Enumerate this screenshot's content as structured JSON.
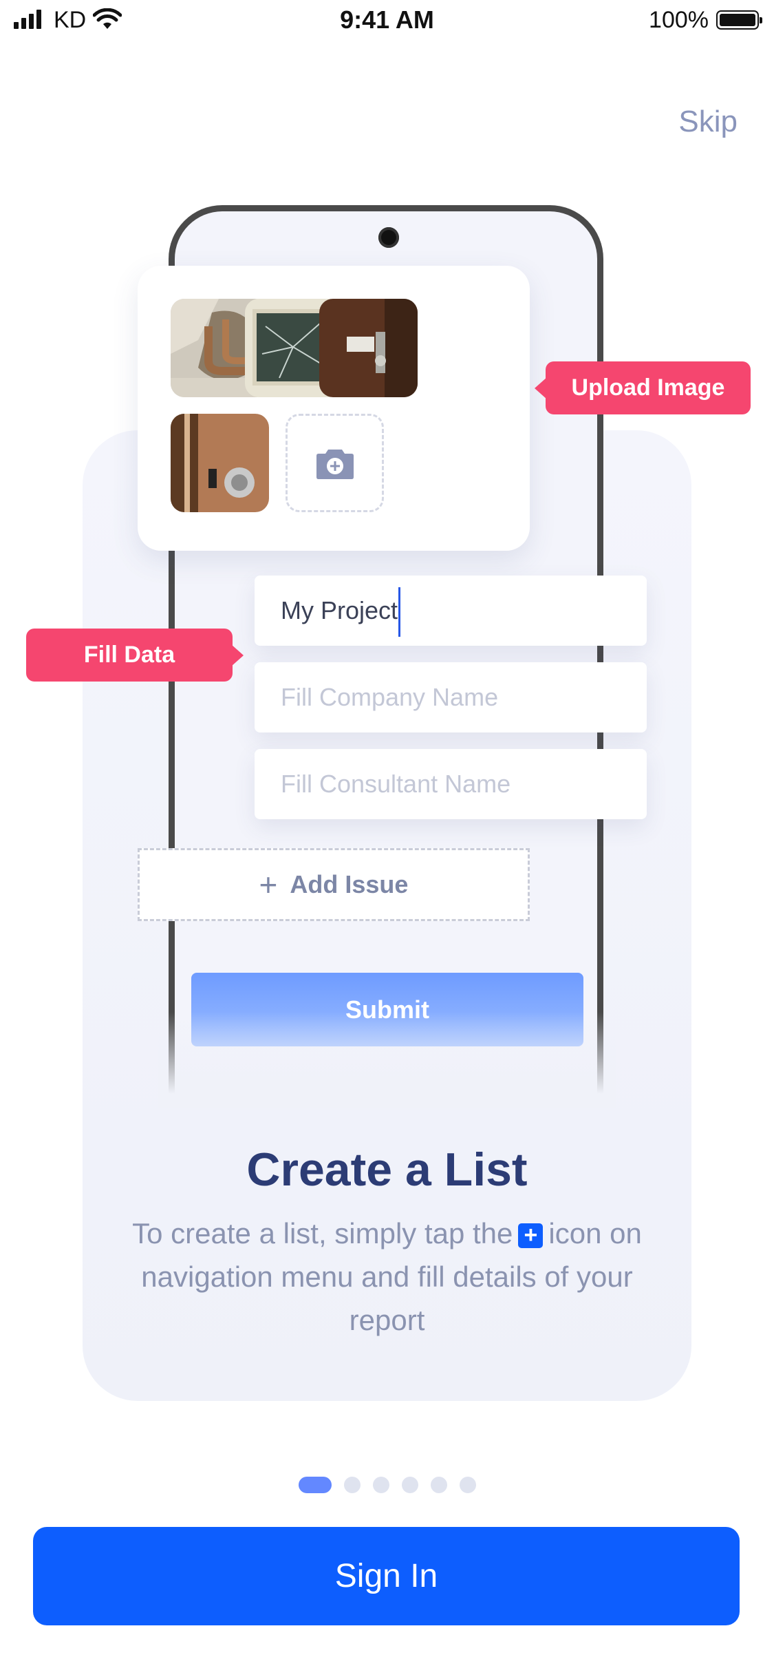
{
  "status_bar": {
    "carrier": "KD",
    "time": "9:41 AM",
    "battery": "100%"
  },
  "skip_label": "Skip",
  "illustration": {
    "upload_tag": "Upload Image",
    "fill_tag": "Fill Data",
    "fields": [
      {
        "value": "My Project"
      },
      {
        "placeholder": "Fill Company Name"
      },
      {
        "placeholder": "Fill Consultant Name"
      }
    ],
    "add_issue_label": "Add Issue",
    "submit_label": "Submit"
  },
  "onboarding": {
    "title": "Create a List",
    "desc_part1": "To create a list, simply tap the",
    "desc_part2": "icon on navigation menu and fill details of your report"
  },
  "pagination": {
    "current": 1,
    "total": 6
  },
  "signin_label": "Sign In",
  "colors": {
    "primary": "#0d5efe",
    "accent_tag": "#f5466f",
    "title": "#2c3c75"
  }
}
